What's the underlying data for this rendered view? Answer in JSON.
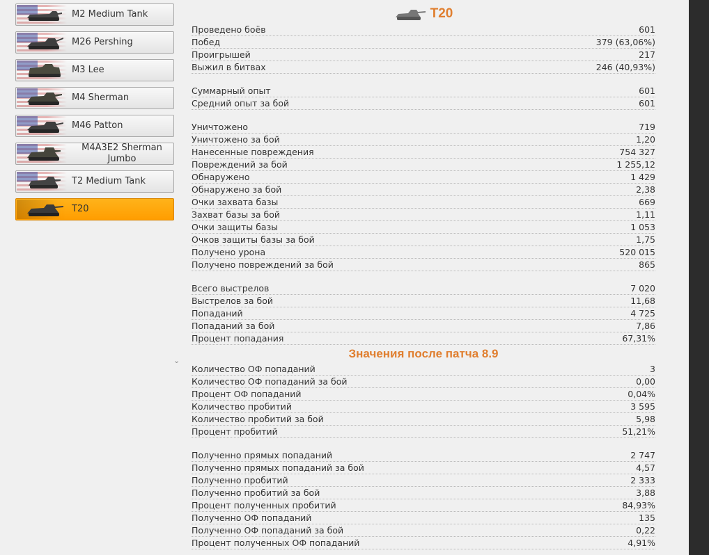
{
  "sidebar": {
    "items": [
      {
        "label": "M2 Medium Tank",
        "active": false
      },
      {
        "label": "M26 Pershing",
        "active": false
      },
      {
        "label": "M3 Lee",
        "active": false
      },
      {
        "label": "M4 Sherman",
        "active": false
      },
      {
        "label": "M46 Patton",
        "active": false
      },
      {
        "label": "M4A3E2 Sherman Jumbo",
        "active": false
      },
      {
        "label": "T2 Medium Tank",
        "active": false
      },
      {
        "label": "T20",
        "active": true
      }
    ]
  },
  "colors": {
    "accent": "#ff9d00",
    "title": "#e07f30",
    "dark_bar": "#2c2c2c"
  },
  "title": "T20",
  "groups": [
    [
      {
        "k": "Проведено боёв",
        "v": "601"
      },
      {
        "k": "Побед",
        "v": "379 (63,06%)"
      },
      {
        "k": "Проигрышей",
        "v": "217"
      },
      {
        "k": "Выжил в битвах",
        "v": "246 (40,93%)"
      }
    ],
    [
      {
        "k": "Суммарный опыт",
        "v": "601"
      },
      {
        "k": "Средний опыт за бой",
        "v": "601"
      }
    ],
    [
      {
        "k": "Уничтожено",
        "v": "719"
      },
      {
        "k": "Уничтожено за бой",
        "v": "1,20"
      },
      {
        "k": "Нанесенные повреждения",
        "v": "754 327"
      },
      {
        "k": "Повреждений за бой",
        "v": "1 255,12"
      },
      {
        "k": "Обнаружено",
        "v": "1 429"
      },
      {
        "k": "Обнаружено за бой",
        "v": "2,38"
      },
      {
        "k": "Очки захвата базы",
        "v": "669"
      },
      {
        "k": "Захват базы за бой",
        "v": "1,11"
      },
      {
        "k": "Очки защиты базы",
        "v": "1 053"
      },
      {
        "k": "Очков защиты базы за бой",
        "v": "1,75"
      },
      {
        "k": "Получено урона",
        "v": "520 015"
      },
      {
        "k": "Получено повреждений за бой",
        "v": "865"
      }
    ],
    [
      {
        "k": "Всего выстрелов",
        "v": "7 020"
      },
      {
        "k": "Выстрелов за бой",
        "v": "11,68"
      },
      {
        "k": "Попаданий",
        "v": "4 725"
      },
      {
        "k": "Попаданий за бой",
        "v": "7,86"
      },
      {
        "k": "Процент попадания",
        "v": "67,31%"
      }
    ]
  ],
  "section_title": "Значения после патча 8.9",
  "groups2": [
    [
      {
        "k": "Количество ОФ попаданий",
        "v": "3"
      },
      {
        "k": "Количество ОФ попаданий за бой",
        "v": "0,00"
      },
      {
        "k": "Процент ОФ попаданий",
        "v": "0,04%"
      },
      {
        "k": "Количество пробитий",
        "v": "3 595"
      },
      {
        "k": "Количество пробитий за бой",
        "v": "5,98"
      },
      {
        "k": "Процент пробитий",
        "v": "51,21%"
      }
    ],
    [
      {
        "k": "Полученно прямых попаданий",
        "v": "2 747"
      },
      {
        "k": "Полученнo прямых попаданий за бой",
        "v": "4,57"
      },
      {
        "k": "Полученно пробитий",
        "v": "2 333"
      },
      {
        "k": "Полученно пробитий за бой",
        "v": "3,88"
      },
      {
        "k": "Процент полученных пробитий",
        "v": "84,93%"
      },
      {
        "k": "Полученно ОФ попаданий",
        "v": "135"
      },
      {
        "k": "Полученно ОФ попаданий за бой",
        "v": "0,22"
      },
      {
        "k": "Процент полученных ОФ попаданий",
        "v": "4,91%"
      }
    ]
  ]
}
